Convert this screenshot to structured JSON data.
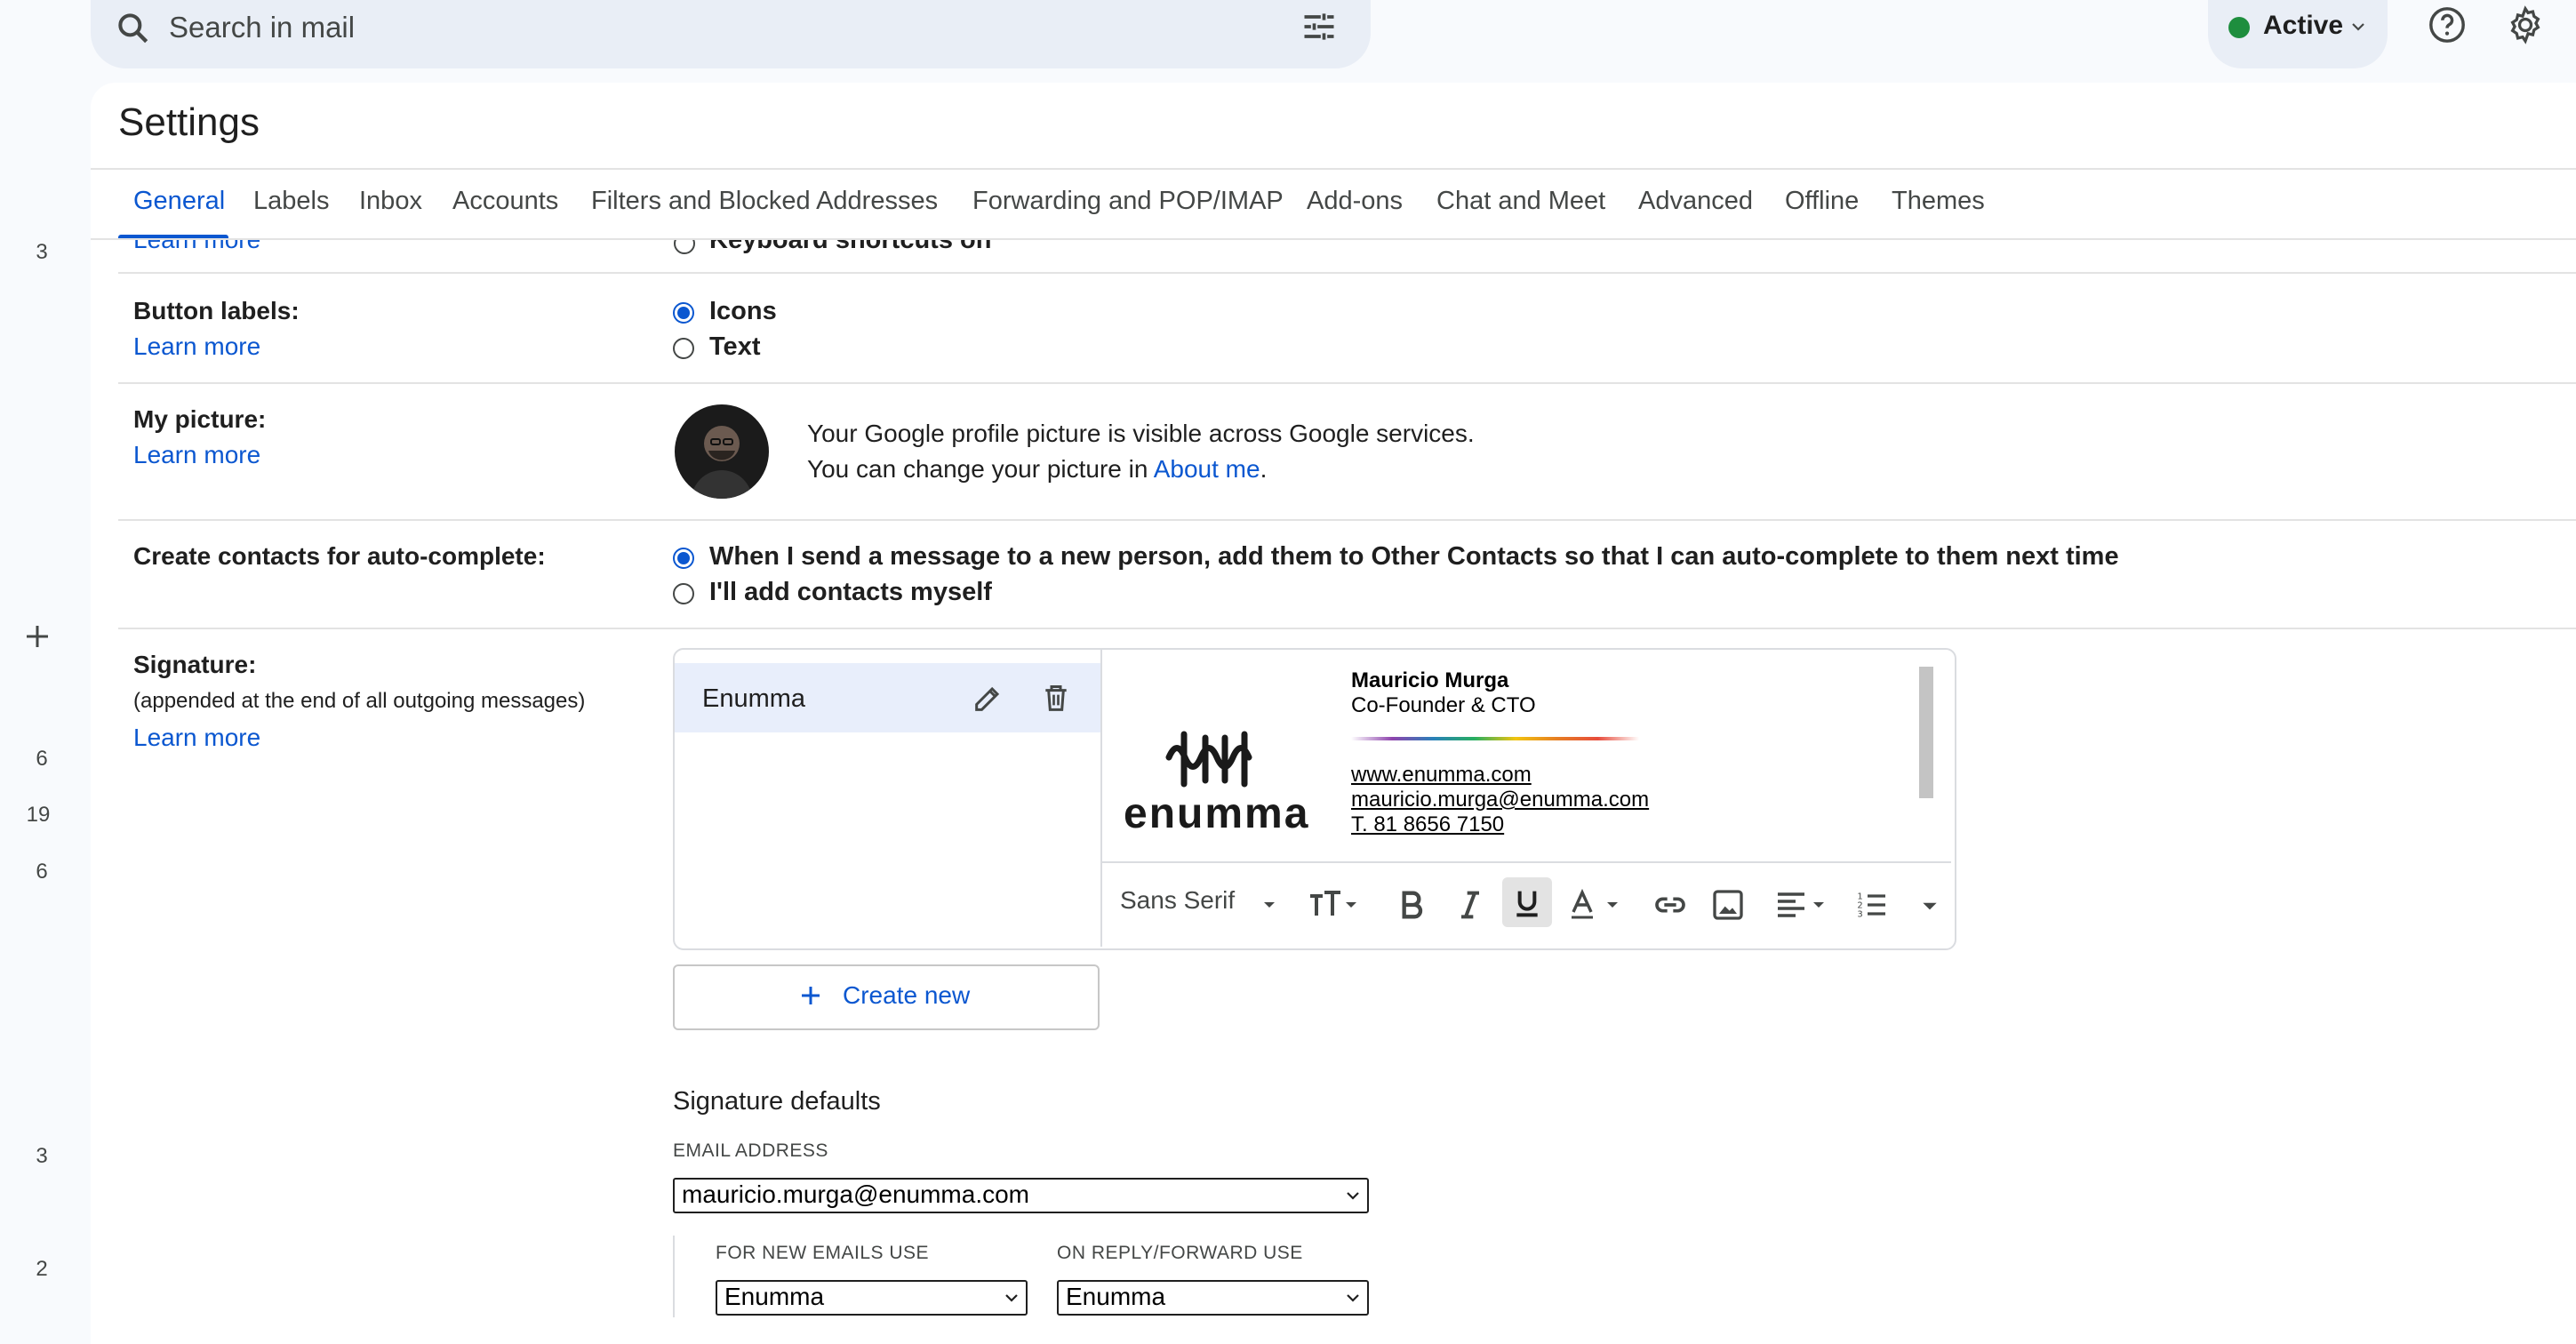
{
  "rail": {
    "counts": [
      "3",
      "6",
      "19",
      "6",
      "3",
      "2"
    ]
  },
  "search": {
    "placeholder": "Search in mail"
  },
  "status": {
    "label": "Active",
    "color": "#1e8e3e"
  },
  "settings": {
    "title": "Settings",
    "tabs": [
      "General",
      "Labels",
      "Inbox",
      "Accounts",
      "Filters and Blocked Addresses",
      "Forwarding and POP/IMAP",
      "Add-ons",
      "Chat and Meet",
      "Advanced",
      "Offline",
      "Themes"
    ],
    "active_tab": "General"
  },
  "partial_row": {
    "link": "Learn more",
    "option": "Keyboard shortcuts on"
  },
  "button_labels": {
    "label": "Button labels:",
    "learn_more": "Learn more",
    "options": [
      "Icons",
      "Text"
    ],
    "selected": "Icons"
  },
  "my_picture": {
    "label": "My picture:",
    "learn_more": "Learn more",
    "line1": "Your Google profile picture is visible across Google services.",
    "line2_prefix": "You can change your picture in ",
    "line2_link": "About me",
    "line2_suffix": "."
  },
  "contacts": {
    "label": "Create contacts for auto-complete:",
    "options": [
      "When I send a message to a new person, add them to Other Contacts so that I can auto-complete to them next time",
      "I'll add contacts myself"
    ],
    "selected": "When I send a message to a new person, add them to Other Contacts so that I can auto-complete to them next time"
  },
  "signature": {
    "label": "Signature:",
    "sublabel": "(appended at the end of all outgoing messages)",
    "learn_more": "Learn more",
    "selected_name": "Enumma",
    "preview": {
      "logo_text": "enumma",
      "name": "Mauricio Murga",
      "role": "Co-Founder & CTO",
      "website": "www.enumma.com",
      "email": "mauricio.murga@enumma.com",
      "phone": "T. 81 8656 7150"
    },
    "toolbar": {
      "font": "Sans Serif",
      "icons": [
        "font-size-icon",
        "bold-icon",
        "italic-icon",
        "underline-icon",
        "text-color-icon",
        "link-icon",
        "image-icon",
        "align-icon",
        "numbered-list-icon",
        "more-options-icon"
      ]
    },
    "create_new": "Create new"
  },
  "defaults": {
    "title": "Signature defaults",
    "email_label": "EMAIL ADDRESS",
    "email_value": "mauricio.murga@enumma.com",
    "new_label": "FOR NEW EMAILS USE",
    "new_value": "Enumma",
    "reply_label": "ON REPLY/FORWARD USE",
    "reply_value": "Enumma"
  }
}
